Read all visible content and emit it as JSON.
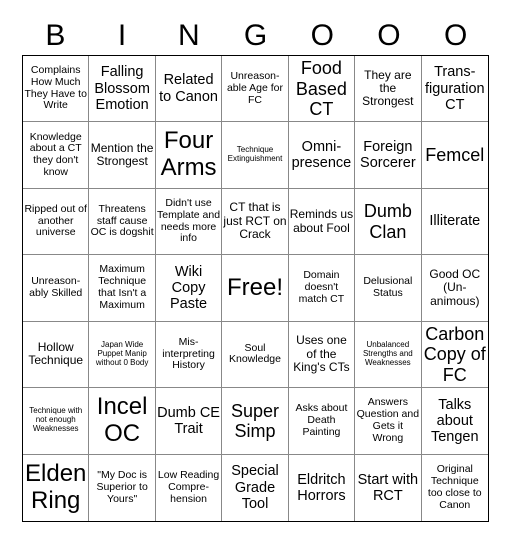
{
  "header": [
    "B",
    "I",
    "N",
    "G",
    "O",
    "O",
    "O"
  ],
  "cells": [
    {
      "text": "Complains How Much They Have to Write",
      "size": "s-s"
    },
    {
      "text": "Falling Blossom Emotion",
      "size": "s-l"
    },
    {
      "text": "Related to Canon",
      "size": "s-l"
    },
    {
      "text": "Unreason-able Age for FC",
      "size": "s-s"
    },
    {
      "text": "Food Based CT",
      "size": "s-xl"
    },
    {
      "text": "They are the Strongest",
      "size": "s-m"
    },
    {
      "text": "Trans-figuration CT",
      "size": "s-l"
    },
    {
      "text": "Knowledge about a CT they don't know",
      "size": "s-s"
    },
    {
      "text": "Mention the Strongest",
      "size": "s-m"
    },
    {
      "text": "Four Arms",
      "size": "s-xxl"
    },
    {
      "text": "Technique Extinguishment",
      "size": "s-xs"
    },
    {
      "text": "Omni-presence",
      "size": "s-l"
    },
    {
      "text": "Foreign Sorcerer",
      "size": "s-l"
    },
    {
      "text": "Femcel",
      "size": "s-xl"
    },
    {
      "text": "Ripped out of another universe",
      "size": "s-s"
    },
    {
      "text": "Threatens staff cause OC is dogshit",
      "size": "s-s"
    },
    {
      "text": "Didn't use Template and needs more info",
      "size": "s-s"
    },
    {
      "text": "CT that is just RCT on Crack",
      "size": "s-m"
    },
    {
      "text": "Reminds us about Fool",
      "size": "s-m"
    },
    {
      "text": "Dumb Clan",
      "size": "s-xl"
    },
    {
      "text": "Illiterate",
      "size": "s-l"
    },
    {
      "text": "Unreason-ably Skilled",
      "size": "s-s"
    },
    {
      "text": "Maximum Technique that Isn't a Maximum",
      "size": "s-s"
    },
    {
      "text": "Wiki Copy Paste",
      "size": "s-l"
    },
    {
      "text": "Free!",
      "size": "s-xxl"
    },
    {
      "text": "Domain doesn't match CT",
      "size": "s-s"
    },
    {
      "text": "Delusional Status",
      "size": "s-s"
    },
    {
      "text": "Good OC (Un-animous)",
      "size": "s-m"
    },
    {
      "text": "Hollow Technique",
      "size": "s-m"
    },
    {
      "text": "Japan Wide Puppet Manip without 0 Body",
      "size": "s-xs"
    },
    {
      "text": "Mis-interpreting History",
      "size": "s-s"
    },
    {
      "text": "Soul Knowledge",
      "size": "s-s"
    },
    {
      "text": "Uses one of the King's CTs",
      "size": "s-m"
    },
    {
      "text": "Unbalanced Strengths and Weaknesses",
      "size": "s-xs"
    },
    {
      "text": "Carbon Copy of FC",
      "size": "s-xl"
    },
    {
      "text": "Technique with not enough Weaknesses",
      "size": "s-xs"
    },
    {
      "text": "Incel OC",
      "size": "s-xxl"
    },
    {
      "text": "Dumb CE Trait",
      "size": "s-l"
    },
    {
      "text": "Super Simp",
      "size": "s-xl"
    },
    {
      "text": "Asks about Death Painting",
      "size": "s-s"
    },
    {
      "text": "Answers Question and Gets it Wrong",
      "size": "s-s"
    },
    {
      "text": "Talks about Tengen",
      "size": "s-l"
    },
    {
      "text": "Elden Ring",
      "size": "s-xxl"
    },
    {
      "text": "\"My Doc is Superior to Yours\"",
      "size": "s-s"
    },
    {
      "text": "Low Reading Compre-hension",
      "size": "s-s"
    },
    {
      "text": "Special Grade Tool",
      "size": "s-l"
    },
    {
      "text": "Eldritch Horrors",
      "size": "s-l"
    },
    {
      "text": "Start with RCT",
      "size": "s-l"
    },
    {
      "text": "Original Technique too close to Canon",
      "size": "s-s"
    }
  ]
}
